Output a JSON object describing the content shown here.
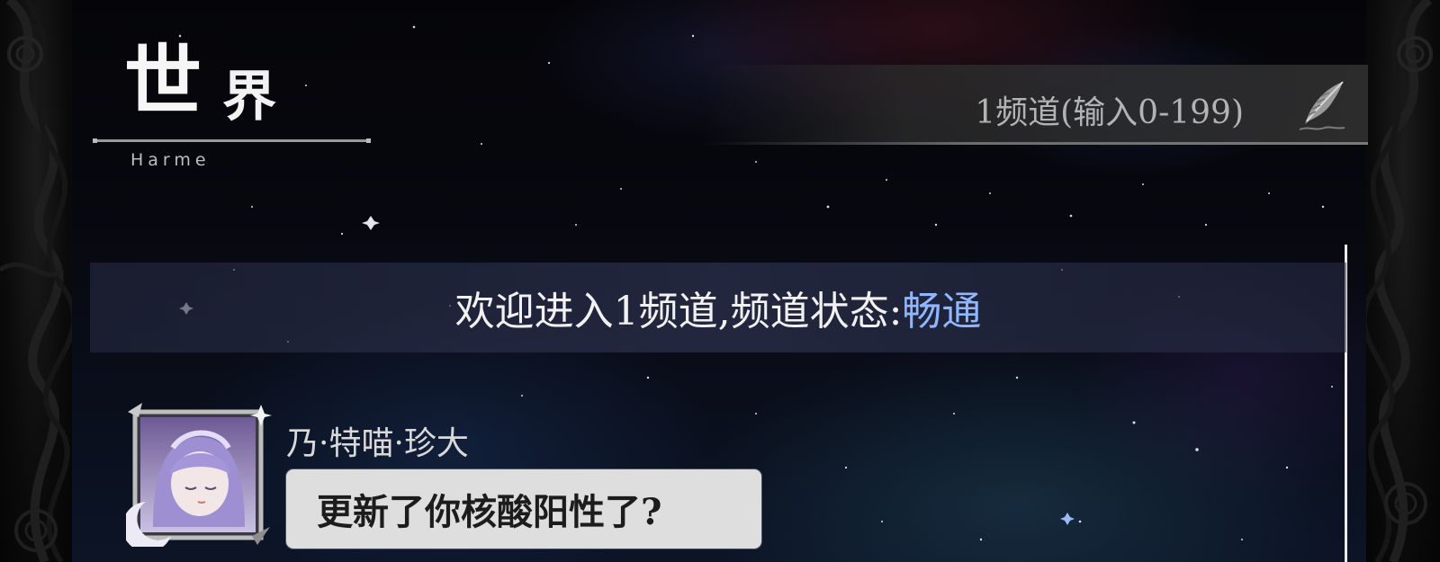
{
  "header": {
    "title_main": "世",
    "title_rest": "界",
    "title_roman": "Harme"
  },
  "channel": {
    "input_placeholder": "1频道(输入0-199)",
    "edit_icon": "quill-icon"
  },
  "welcome": {
    "prefix": "欢迎进入1频道,频道状态:",
    "status": "畅通",
    "status_color": "#8fb6ff"
  },
  "messages": [
    {
      "sender": "乃·特喵·珍大",
      "text": "更新了你核酸阳性了?",
      "avatar_icon": "sleeping-girl-avatar"
    }
  ]
}
